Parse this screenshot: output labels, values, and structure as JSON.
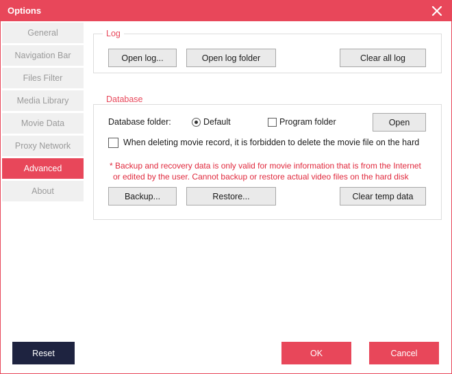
{
  "window": {
    "title": "Options"
  },
  "sidebar": {
    "items": [
      {
        "label": "General"
      },
      {
        "label": "Navigation Bar"
      },
      {
        "label": "Files Filter"
      },
      {
        "label": "Media Library"
      },
      {
        "label": "Movie Data"
      },
      {
        "label": "Proxy Network"
      },
      {
        "label": "Advanced",
        "active": true
      },
      {
        "label": "About"
      }
    ]
  },
  "log": {
    "title": "Log",
    "open_log": "Open log...",
    "open_log_folder": "Open log folder",
    "clear_all_log": "Clear all log"
  },
  "database": {
    "title": "Database",
    "folder_label": "Database folder:",
    "option_default": "Default",
    "option_default_selected": true,
    "option_program": "Program folder",
    "option_program_checked": false,
    "open_button": "Open",
    "forbid_delete_label": "When deleting movie record, it is forbidden to delete the movie file on the hard",
    "forbid_delete_checked": false,
    "warning_line1": "* Backup and recovery data is only valid for movie information that is from the Internet",
    "warning_line2": "or edited by the user. Cannot backup or restore actual video files on the hard disk",
    "backup": "Backup...",
    "restore": "Restore...",
    "clear_temp": "Clear temp data"
  },
  "footer": {
    "reset": "Reset",
    "ok": "OK",
    "cancel": "Cancel"
  },
  "colors": {
    "accent": "#e8475a",
    "dark_button": "#1e2340",
    "warning_text": "#e0283c"
  }
}
